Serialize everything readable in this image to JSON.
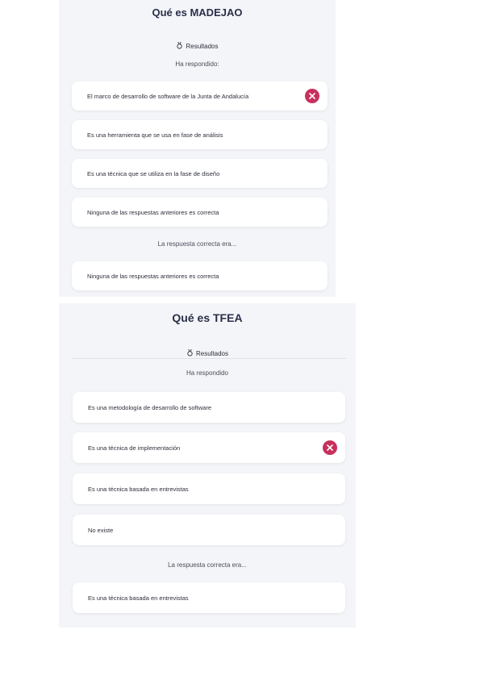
{
  "panels": [
    {
      "title": "Qué es MADEJAO",
      "results_label": "Resultados",
      "answered_label": "Ha respondido:",
      "options": [
        {
          "text": "El marco de desarrollo de software de la Junta de Andalucía",
          "selected_wrong": true
        },
        {
          "text": "Es una herramienta que se usa en fase de análisis",
          "selected_wrong": false
        },
        {
          "text": "Es una técnica que se utiliza en la fase de diseño",
          "selected_wrong": false
        },
        {
          "text": "Ninguna de las respuestas anteriores es correcta",
          "selected_wrong": false
        }
      ],
      "correct_label": "La respuesta correcta era...",
      "correct_answer": "Ninguna de las respuestas anteriores es correcta"
    },
    {
      "title": "Qué es TFEA",
      "results_label": "Resultados",
      "answered_label": "Ha respondido",
      "options": [
        {
          "text": "Es una metodología de desarrollo de software",
          "selected_wrong": false
        },
        {
          "text": "Es una técnica de implementación",
          "selected_wrong": true
        },
        {
          "text": "Es una técnica basada en entrevistas",
          "selected_wrong": false
        },
        {
          "text": "No existe",
          "selected_wrong": false
        }
      ],
      "correct_label": "La respuesta correcta era...",
      "correct_answer": "Es una técnica basada en entrevistas"
    }
  ],
  "icons": {
    "results": "medal-icon",
    "wrong": "close-icon"
  },
  "colors": {
    "panel_bg": "#f4f5f8",
    "wrong_badge": "#c8305b",
    "title": "#2a2f4a"
  }
}
